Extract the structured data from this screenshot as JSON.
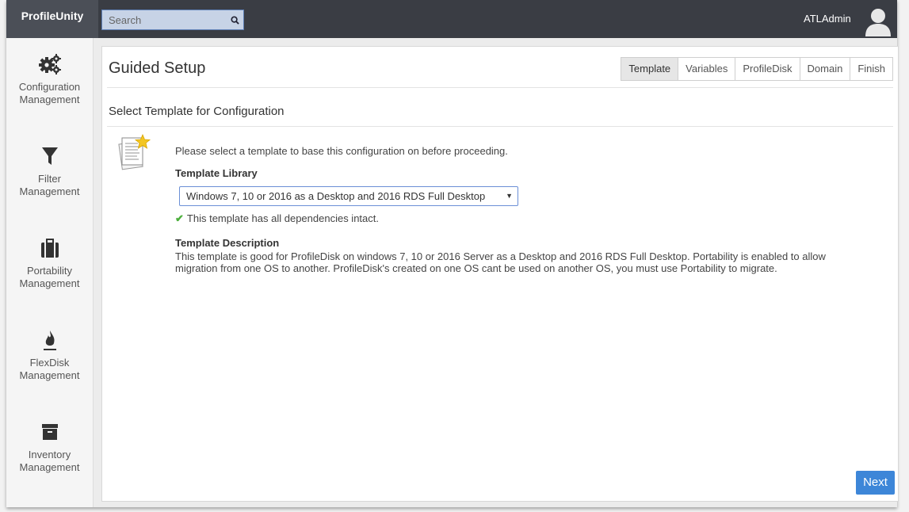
{
  "app": {
    "title": "ProfileUnity"
  },
  "search": {
    "placeholder": "Search"
  },
  "user": {
    "name": "ATLAdmin"
  },
  "sidebar": {
    "items": [
      {
        "line1": "Configuration",
        "line2": "Management",
        "icon": "gears-icon"
      },
      {
        "line1": "Filter",
        "line2": "Management",
        "icon": "filter-icon"
      },
      {
        "line1": "Portability",
        "line2": "Management",
        "icon": "briefcase-icon"
      },
      {
        "line1": "FlexDisk",
        "line2": "Management",
        "icon": "flame-icon"
      },
      {
        "line1": "Inventory",
        "line2": "Management",
        "icon": "archive-icon"
      }
    ]
  },
  "main": {
    "title": "Guided Setup",
    "tabs": [
      {
        "label": "Template",
        "active": true
      },
      {
        "label": "Variables",
        "active": false
      },
      {
        "label": "ProfileDisk",
        "active": false
      },
      {
        "label": "Domain",
        "active": false
      },
      {
        "label": "Finish",
        "active": false
      }
    ],
    "section_title": "Select Template for Configuration",
    "intro": "Please select a template to base this configuration on before proceeding.",
    "library_label": "Template Library",
    "library_value": "Windows 7, 10 or 2016 as a Desktop and 2016 RDS Full Desktop",
    "dependency_status": "This template has all dependencies intact.",
    "description_label": "Template Description",
    "description_line1": "This template is good for ProfileDisk on windows 7, 10 or 2016 Server as a Desktop and 2016 RDS Full Desktop. Portability is enabled to allow",
    "description_line2": "migration from one OS to another. ProfileDisk's created on one OS cant be used on another OS, you must use Portability to migrate.",
    "next_label": "Next"
  },
  "colors": {
    "topbar": "#3a3d44",
    "accent": "#3d86d8",
    "success": "#4caf3c"
  }
}
